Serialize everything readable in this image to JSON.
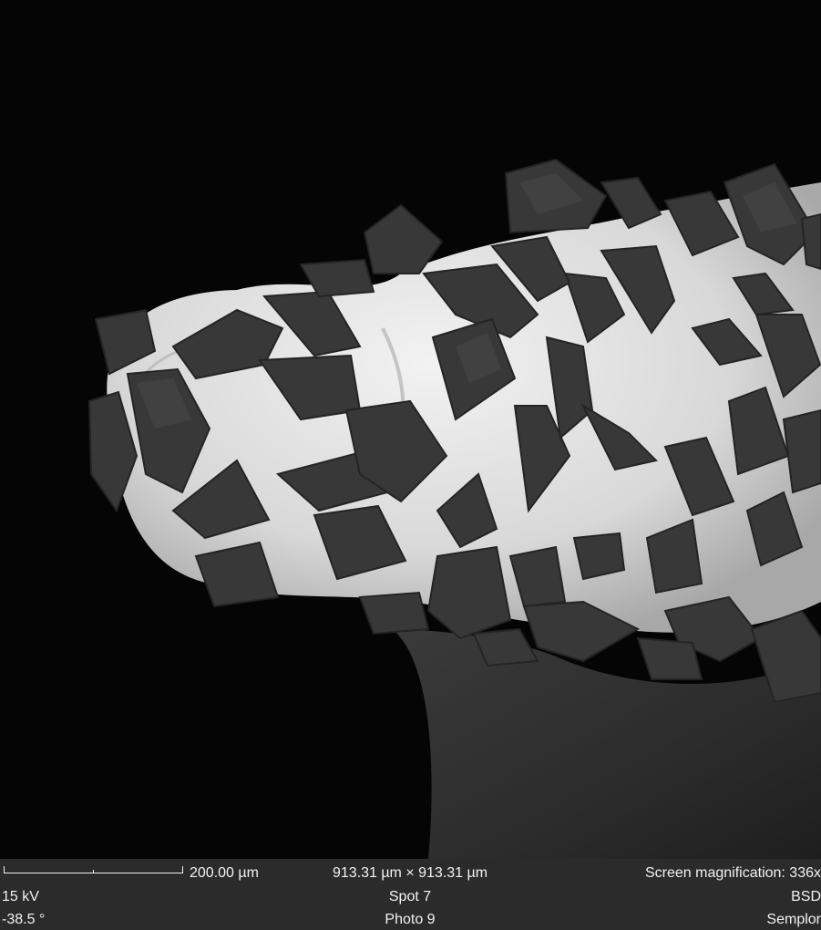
{
  "image": {
    "description_icon": "sem-micrograph",
    "background_color": "#000000",
    "coating_color": "#e6e6e6",
    "particle_color": "#3a3a3a"
  },
  "info_bar": {
    "background_color": "#2b2b2b",
    "text_color": "#f2f2f2",
    "scale_bar_label": "200.00 µm",
    "field_of_view": "913.31 µm × 913.31 µm",
    "screen_magnification": "Screen magnification: 336x",
    "voltage": "15  kV",
    "spot": "Spot 7",
    "detector": "BSD",
    "tilt": "-38.5 °",
    "photo": "Photo 9",
    "brand": "Semplor"
  }
}
